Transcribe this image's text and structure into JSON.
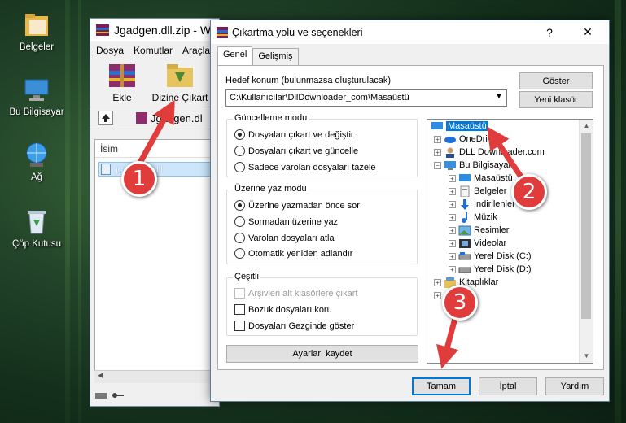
{
  "desktop": {
    "icons": [
      {
        "label": "Belgeler"
      },
      {
        "label": "Bu Bilgisayar"
      },
      {
        "label": "Ağ"
      },
      {
        "label": "Çöp Kutusu"
      }
    ]
  },
  "rar_window": {
    "title": "Jgadgen.dll.zip - Wi",
    "menu": [
      "Dosya",
      "Komutlar",
      "Araçla"
    ],
    "toolbar": [
      "Ekle",
      "Dizine Çıkart"
    ],
    "address": "Jgadgen.dl",
    "list_header": "İsim",
    "file": "jgadgen.dll"
  },
  "dialog": {
    "title": "Çıkartma yolu ve seçenekleri",
    "help": "?",
    "close": "✕",
    "tabs": [
      "Genel",
      "Gelişmiş"
    ],
    "dest_label": "Hedef konum (bulunmazsa oluşturulacak)",
    "dest_value": "C:\\Kullanıcılar\\DllDownloader_com\\Masaüstü",
    "show_btn": "Göster",
    "new_folder_btn": "Yeni klasör",
    "update_mode": {
      "title": "Güncelleme modu",
      "options": [
        "Dosyaları çıkart ve değiştir",
        "Dosyaları çıkart ve güncelle",
        "Sadece varolan dosyaları tazele"
      ]
    },
    "overwrite_mode": {
      "title": "Üzerine yaz modu",
      "options": [
        "Üzerine yazmadan önce sor",
        "Sormadan üzerine yaz",
        "Varolan dosyaları atla",
        "Otomatik yeniden adlandır"
      ]
    },
    "misc": {
      "title": "Çeşitli",
      "options": [
        "Arşivleri alt klasörlere çıkart",
        "Bozuk dosyaları koru",
        "Dosyaları Gezginde göster"
      ]
    },
    "save_btn": "Ayarları kaydet",
    "tree": [
      "Masaüstü",
      "OneDrive",
      "DLL Downloader.com",
      "Bu Bilgisayar",
      "Masaüstü",
      "Belgeler",
      "İndirilenler",
      "Müzik",
      "Resimler",
      "Videolar",
      "Yerel Disk (C:)",
      "Yerel Disk (D:)",
      "Kitaplıklar",
      "Ağ"
    ],
    "ok_btn": "Tamam",
    "cancel_btn": "İptal",
    "help_btn": "Yardım"
  },
  "steps": [
    "1",
    "2",
    "3"
  ],
  "colors": {
    "accent": "#0078d7",
    "badge": "#e03c3c",
    "arrow": "#e03c3c"
  }
}
